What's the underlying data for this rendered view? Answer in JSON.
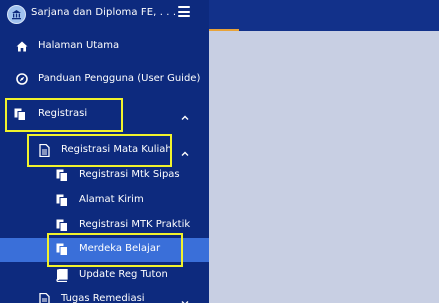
{
  "brand": {
    "title": "Sarjana dan Diploma FE, . . ."
  },
  "menu": {
    "home": "Halaman Utama",
    "guide": "Panduan Pengguna (User Guide)",
    "registrasi": "Registrasi",
    "registrasi_mk": "Registrasi Mata Kuliah",
    "sipas": "Registrasi Mtk Sipas",
    "alamat": "Alamat Kirim",
    "praktik": "Registrasi MTK Praktik",
    "merdeka": "Merdeka Belajar",
    "tuton": "Update Reg Tuton",
    "remedial": "Tugas Remediasi"
  },
  "colors": {
    "sidebar": "#0d2a7e",
    "active_item": "#3a6fd9",
    "highlight": "#f1f32c",
    "content_bg": "#c8cfe3",
    "accent": "#e8a33a"
  }
}
